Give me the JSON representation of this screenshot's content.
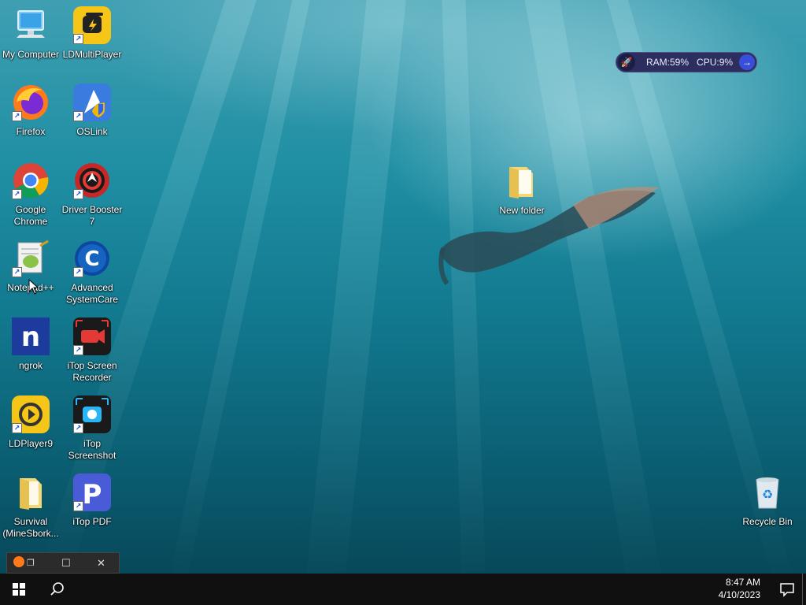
{
  "desktop_icons": {
    "my_computer": "My Computer",
    "ldmultiplayer": "LDMultiPlayer",
    "firefox": "Firefox",
    "oslink": "OSLink",
    "google_chrome": "Google Chrome",
    "driver_booster": "Driver Booster 7",
    "notepadpp": "Notepad++",
    "advanced_systemcare": "Advanced SystemCare",
    "ngrok": "ngrok",
    "itop_screen_recorder": "iTop Screen Recorder",
    "ldplayer9": "LDPlayer9",
    "itop_screenshot": "iTop Screenshot",
    "survival": "Survival (MineSbork...",
    "itop_pdf": "iTop PDF",
    "new_folder": "New folder",
    "recycle_bin": "Recycle Bin"
  },
  "widget": {
    "ram_label": "RAM:",
    "ram_value": "59",
    "cpu_label": "CPU:",
    "cpu_value": "9",
    "unit": "%"
  },
  "taskbar": {
    "time": "8:47 AM",
    "date": "4/10/2023"
  },
  "colors": {
    "taskbar": "#101010",
    "widget_bg": "#2c2f5e",
    "water_top": "#3f9fb2",
    "water_bottom": "#07485a"
  }
}
